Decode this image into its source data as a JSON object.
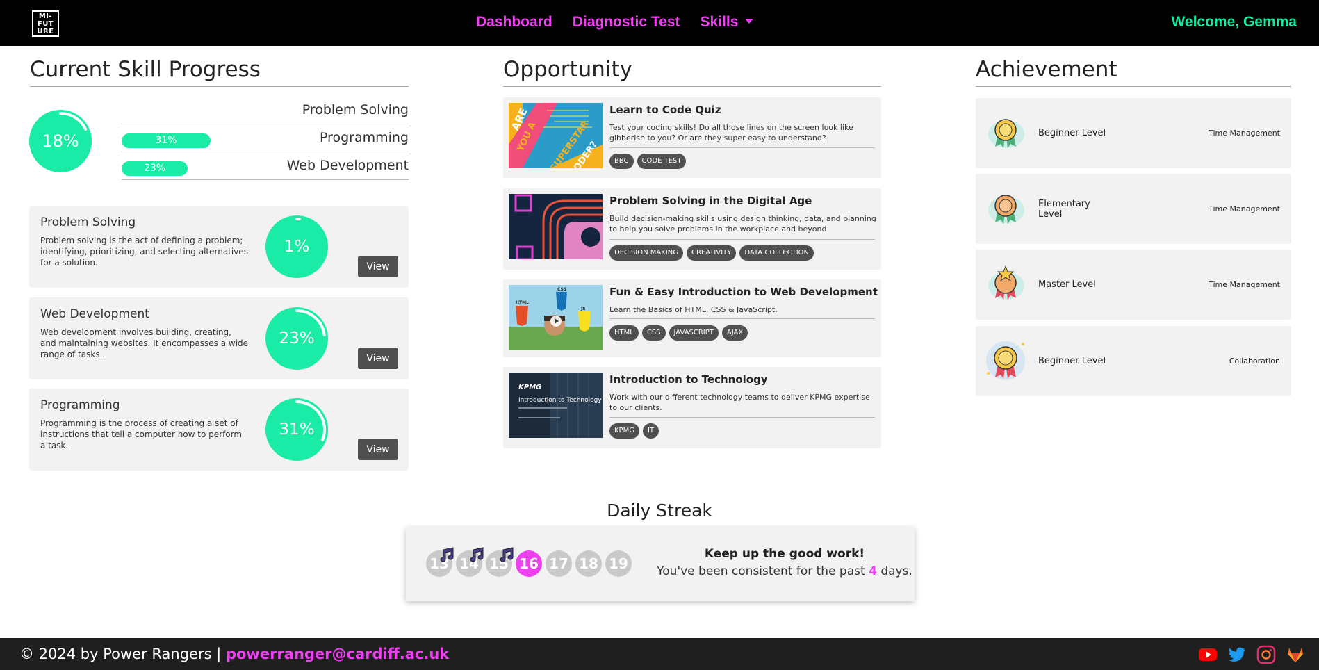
{
  "nav": {
    "logo_lines": [
      "MI-",
      "FUT",
      "URE"
    ],
    "links": [
      "Dashboard",
      "Diagnostic Test",
      "Skills"
    ],
    "welcome": "Welcome, Gemma"
  },
  "skill_progress": {
    "title": "Current Skill Progress",
    "overall_percent": "18%",
    "overall_value": 18,
    "rows": [
      {
        "label": "Problem Solving",
        "pill": "",
        "value": 1
      },
      {
        "label": "Programming",
        "pill": "31%",
        "value": 31
      },
      {
        "label": "Web Development",
        "pill": "23%",
        "value": 23
      }
    ],
    "cards": [
      {
        "title": "Problem Solving",
        "desc": "Problem solving is the act of defining a problem; identifying, prioritizing, and selecting alternatives for a solution.",
        "percent": "1%",
        "value": 1,
        "button": "View"
      },
      {
        "title": "Web Development",
        "desc": "Web development involves building, creating, and maintaining websites. It encompasses a wide range of tasks..",
        "percent": "23%",
        "value": 23,
        "button": "View"
      },
      {
        "title": "Programming",
        "desc": "Programming is the process of creating a set of instructions that tell a computer how to perform a task.",
        "percent": "31%",
        "value": 31,
        "button": "View"
      }
    ]
  },
  "opportunity": {
    "title": "Opportunity",
    "items": [
      {
        "title": "Learn to Code Quiz",
        "desc": "Test your coding skills! Do all those lines on the screen look like gibberish to you? Or are they super easy to understand?",
        "tags": [
          "BBC",
          "CODE TEST"
        ],
        "thumb_text": [
          "ARE",
          "YOU A",
          "SUPERSTAR",
          "CODER?"
        ]
      },
      {
        "title": "Problem Solving in the Digital Age",
        "desc": "Build decision-making skills using design thinking, data, and planning to help you solve problems in the workplace and beyond.",
        "tags": [
          "DECISION MAKING",
          "CREATIVITY",
          "DATA COLLECTION"
        ]
      },
      {
        "title": "Fun & Easy Introduction to Web Development",
        "desc": "Learn the Basics of HTML, CSS & JavaScript.",
        "tags": [
          "HTML",
          "CSS",
          "JAVASCRIPT",
          "AJAX"
        ],
        "thumb_text": [
          "HTML",
          "CSS",
          "JS"
        ]
      },
      {
        "title": "Introduction to Technology",
        "desc": "Work with our different technology teams to deliver KPMG expertise to our clients.",
        "tags": [
          "KPMG",
          "IT"
        ],
        "thumb_text": [
          "KPMG",
          "Introduction to Technology"
        ]
      }
    ]
  },
  "achievement": {
    "title": "Achievement",
    "items": [
      {
        "level": "Beginner Level",
        "category": "Time Management",
        "icon": "medal-icon"
      },
      {
        "level": "Elementary Level",
        "category": "Time Management",
        "icon": "medal-icon"
      },
      {
        "level": "Master Level",
        "category": "Time Management",
        "icon": "medal-star-icon"
      },
      {
        "level": "Beginner Level",
        "category": "Collaboration",
        "icon": "medal-icon"
      }
    ]
  },
  "streak": {
    "title": "Daily Streak",
    "days": [
      "13",
      "14",
      "15",
      "16",
      "17",
      "18",
      "19"
    ],
    "today": "16",
    "completed_days": [
      "13",
      "14",
      "15"
    ],
    "message_title": "Keep up the good work!",
    "message_prefix": "You've been consistent for the past",
    "count": "4",
    "message_suffix": "days."
  },
  "footer": {
    "copyright": "© 2024 by Power Rangers |",
    "email": "powerranger@cardiff.ac.uk",
    "socials": [
      "youtube-icon",
      "twitter-icon",
      "instagram-icon",
      "gitlab-icon"
    ]
  },
  "colors": {
    "accent_pink": "#ee3ff0",
    "accent_green": "#19e8a4",
    "navbar_bg": "#000000"
  }
}
